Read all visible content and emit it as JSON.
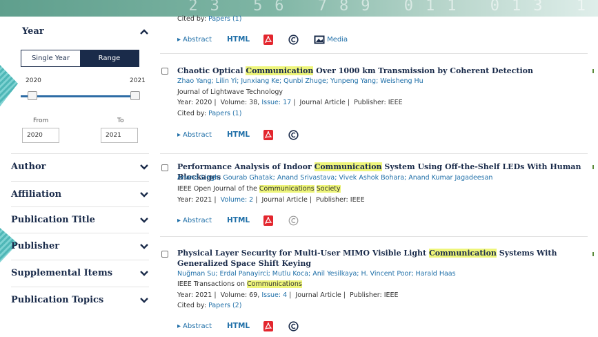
{
  "banner": {
    "digits": "23 56 789 011 013 1"
  },
  "sidebar": {
    "year": {
      "title": "Year",
      "toggle": {
        "single": "Single Year",
        "range": "Range"
      },
      "slider": {
        "min_label": "2020",
        "max_label": "2021"
      },
      "from_label": "From",
      "to_label": "To",
      "from_value": "2020",
      "to_value": "2021"
    },
    "facets": [
      {
        "label": "Author"
      },
      {
        "label": "Affiliation"
      },
      {
        "label": "Publication Title"
      },
      {
        "label": "Publisher"
      },
      {
        "label": "Supplemental Items"
      },
      {
        "label": "Publication Topics"
      }
    ]
  },
  "results": {
    "partial": {
      "cited": {
        "prefix": "Cited by:",
        "link": "Papers (1)"
      },
      "actions": {
        "abstract": "Abstract",
        "html": "HTML",
        "media": "Media"
      }
    },
    "items": [
      {
        "title_before": "Chaotic Optical ",
        "title_hl": "Communication",
        "title_after": " Over 1000 km Transmission by Coherent Detection",
        "authors": "Zhao Yang; Lilin Yi; Junxiang Ke; Qunbi Zhuge; Yunpeng Yang; Weisheng Hu",
        "journal": "Journal of Lightwave Technology",
        "meta": {
          "year": "Year: 2020",
          "volume": "Volume: 38,",
          "issue": "Issue: 17",
          "type": "Journal Article",
          "publisher": "Publisher:  IEEE"
        },
        "cited": {
          "prefix": "Cited by:",
          "link": "Papers (1)"
        },
        "actions": {
          "abstract": "Abstract",
          "html": "HTML"
        }
      },
      {
        "title_before": "Performance Analysis of Indoor ",
        "title_hl": "Communication",
        "title_after": " System Using Off-the-Shelf LEDs With Human Blockages",
        "authors": "Anand Singh; Gourab Ghatak; Anand Srivastava; Vivek Ashok Bohara; Anand Kumar Jagadeesan",
        "journal_before": "IEEE Open Journal of the ",
        "journal_hl1": "Communications",
        "journal_hl2": "Society",
        "meta": {
          "year": "Year: 2021",
          "volume": "Volume: 2",
          "type": "Journal Article",
          "publisher": "Publisher:  IEEE"
        },
        "actions": {
          "abstract": "Abstract",
          "html": "HTML"
        }
      },
      {
        "title_before": "Physical Layer Security for Multi-User MIMO Visible Light ",
        "title_hl": "Communication",
        "title_after": " Systems With Generalized Space Shift Keying",
        "authors": "Nuğman Su; Erdal Panayirci; Mutlu Koca; Anil Yesilkaya; H. Vincent Poor; Harald Haas",
        "journal_before": "IEEE Transactions on ",
        "journal_hl": "Communications",
        "meta": {
          "year": "Year: 2021",
          "volume": "Volume: 69,",
          "issue": "Issue: 4",
          "type": "Journal Article",
          "publisher": "Publisher:  IEEE"
        },
        "cited": {
          "prefix": "Cited by:",
          "link": "Papers (2)"
        },
        "actions": {
          "abstract": "Abstract",
          "html": "HTML"
        }
      }
    ]
  },
  "colors": {
    "navy": "#1a2b4a",
    "link": "#1f6fa8",
    "highlight": "#eef57a",
    "pdf": "#e3262e",
    "slider": "#2d6ca5"
  }
}
